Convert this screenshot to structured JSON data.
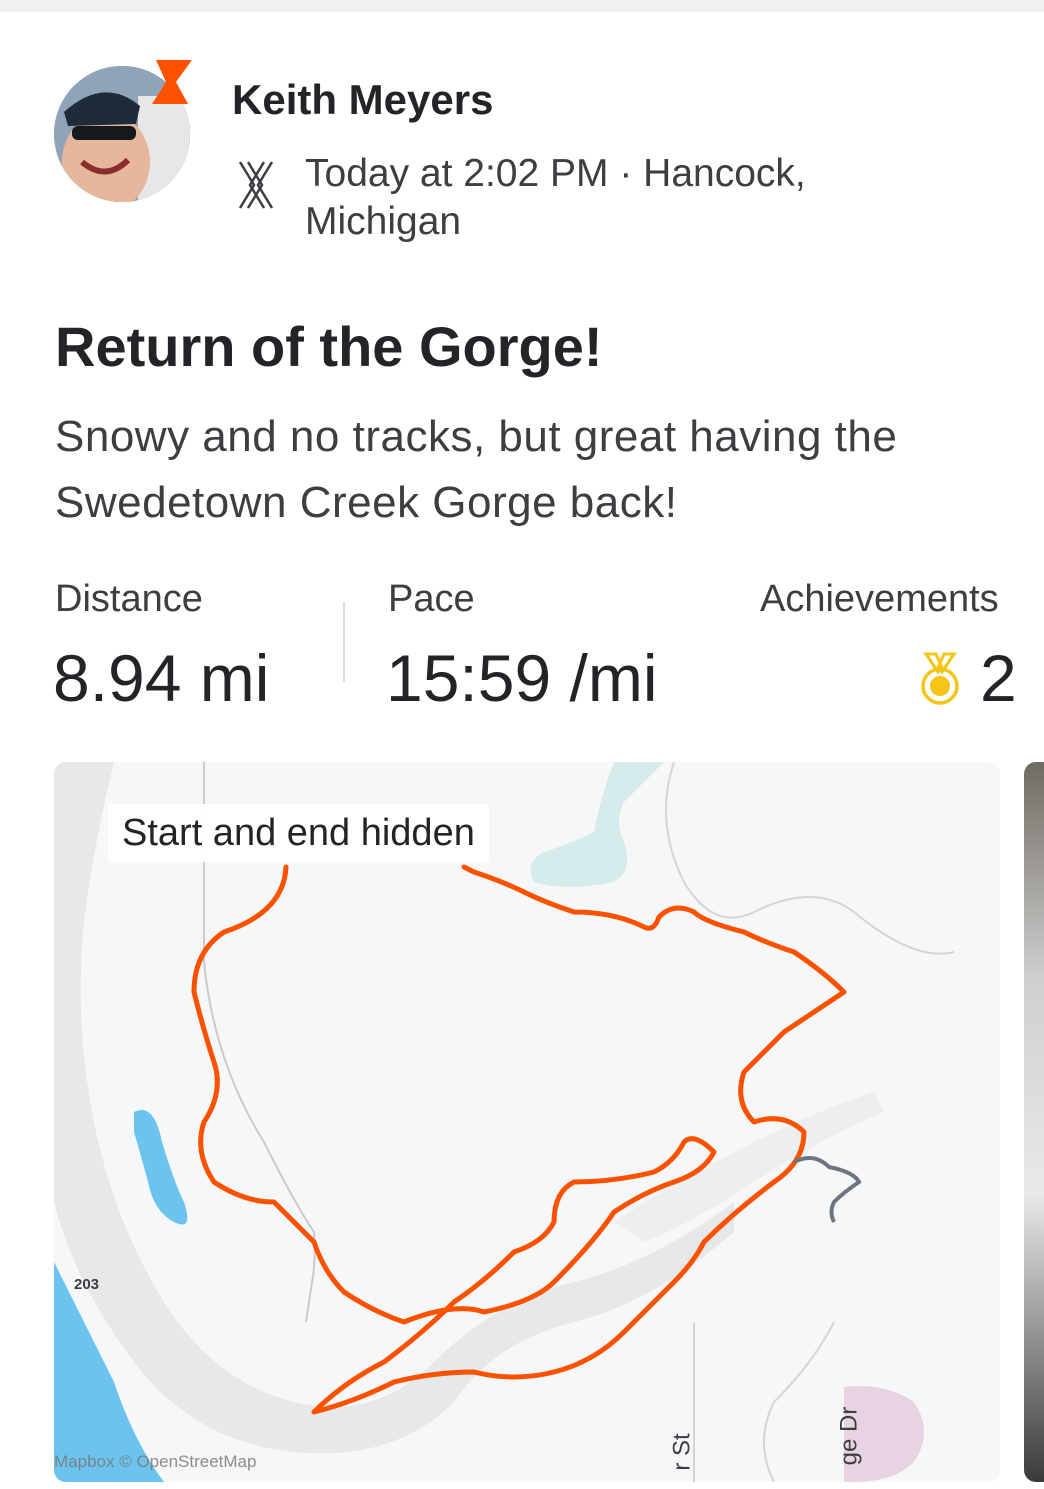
{
  "athlete": {
    "name": "Keith Meyers",
    "meta": "Today at 2:02 PM · Hancock, Michigan"
  },
  "activity": {
    "title": "Return of the Gorge!",
    "description": "Snowy and no tracks, but great having the Swedetown Creek Gorge back!"
  },
  "stats": [
    {
      "label": "Distance",
      "value": "8.94 mi"
    },
    {
      "label": "Pace",
      "value": "15:59 /mi"
    },
    {
      "label": "Achievements",
      "value": "2"
    }
  ],
  "map": {
    "privacy_tag": "Start and end hidden",
    "attribution": "Mapbox © OpenStreetMap",
    "road_number": "203",
    "street_label_1": "r St",
    "street_label_2": "ge Dr",
    "route_color": "#fc5200"
  },
  "colors": {
    "brand": "#fc5200",
    "medal": "#f5c518",
    "water": "#6cc4ee"
  },
  "icons": {
    "device": "x-shaped-device-icon",
    "subscriber_badge": "chevron-badge-icon",
    "achievement": "medal-icon"
  }
}
